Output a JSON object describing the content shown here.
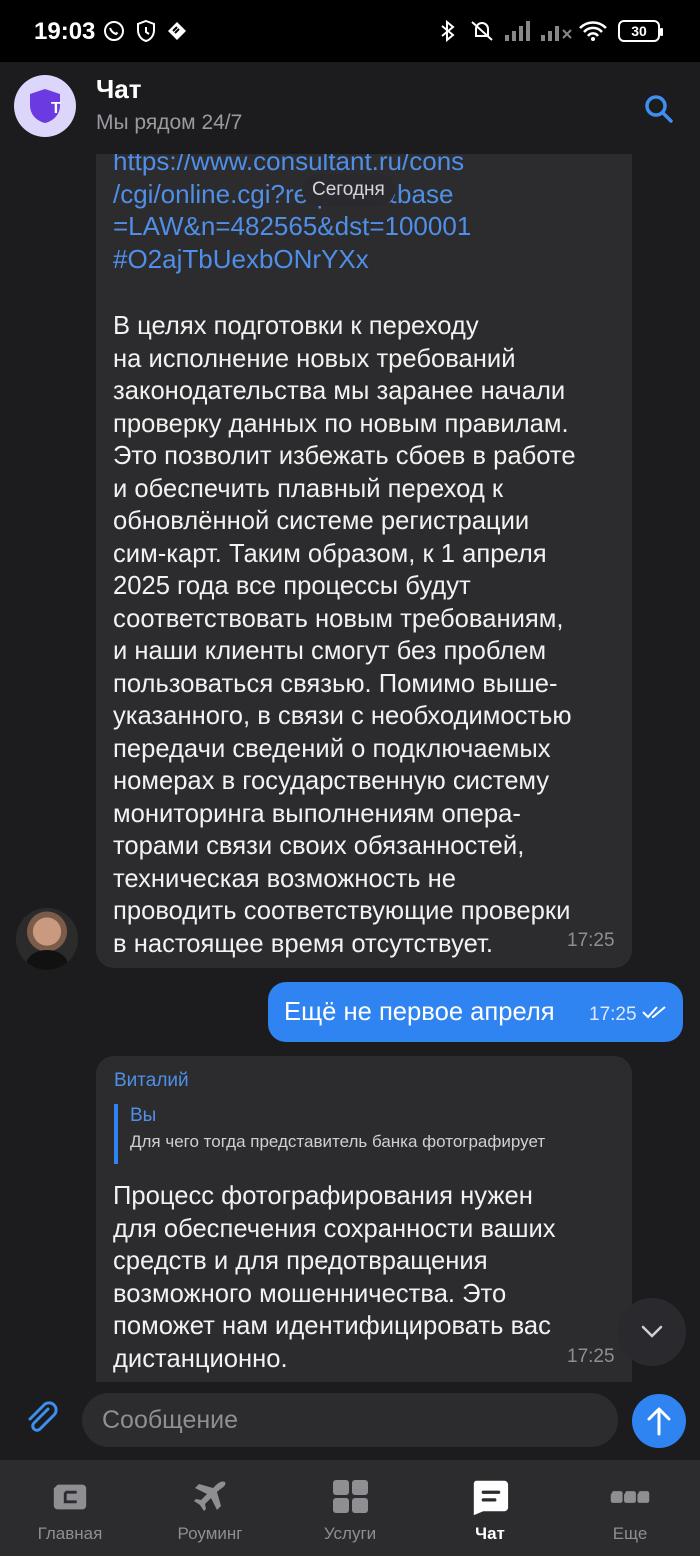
{
  "status_bar": {
    "time": "19:03",
    "battery": "30",
    "icons": [
      "whatsapp-icon",
      "shield-icon",
      "tele2-icon",
      "bluetooth-icon",
      "mute-icon",
      "signal-icon",
      "signal-icon-2",
      "wifi-icon",
      "battery-icon"
    ]
  },
  "header": {
    "title": "Чат",
    "subtitle": "Мы рядом 24/7",
    "avatar_letter": "T"
  },
  "chat": {
    "date_chip": "Сегодня",
    "messages": [
      {
        "direction": "incoming",
        "link": "https://www.consultant.ru/cons\n/cgi/online.cgi?req=doc&base\n=LAW&n=482565&dst=100001\n#O2ajTbUexbONrYXx",
        "text": "В целях подготовки к переходу\nна исполнение новых требований\nзаконодательства мы заранее начали\nпроверку данных по новым правилам.\nЭто позволит избежать сбоев в работе\nи обеспечить плавный переход к\nобновлённой системе регистрации\nсим-карт. Таким образом, к 1 апреля\n2025 года все процессы будут\nсоответствовать новым требованиям,\nи наши клиенты смогут без проблем\nпользоваться связью. Помимо выше-\nуказанного, в связи с необходимостью\nпередачи сведений о подключаемых\nномерах в государственную систему\nмониторинга выполнениям опера-\nторами связи своих обязанностей,\nтехническая возможность не\nпроводить соответствующие проверки\nв настоящее время отсутствует.",
        "time": "17:25"
      },
      {
        "direction": "outgoing",
        "text": "Ещё не первое апреля",
        "time": "17:25"
      },
      {
        "direction": "incoming",
        "sender": "Виталий",
        "quote": {
          "author": "Вы",
          "text": "Для чего тогда представитель банка фотографирует"
        },
        "text": "Процесс фотографирования нужен\nдля обеспечения сохранности ваших\nсредств и для предотвращения\nвозможного мошенничества. Это\nпоможет нам идентифицировать вас\nдистанционно.",
        "time": "17:25"
      }
    ]
  },
  "composer": {
    "placeholder": "Сообщение"
  },
  "nav": {
    "items": [
      {
        "label": "Главная",
        "icon": "home-icon"
      },
      {
        "label": "Роуминг",
        "icon": "plane-icon"
      },
      {
        "label": "Услуги",
        "icon": "services-grid-icon"
      },
      {
        "label": "Чат",
        "icon": "chat-icon",
        "active": true
      },
      {
        "label": "Еще",
        "icon": "more-icon"
      }
    ]
  },
  "colors": {
    "accent": "#2f84f2",
    "link": "#4f8fe8",
    "bubble_in": "#2c2c2e",
    "background": "#1c1c1e"
  }
}
